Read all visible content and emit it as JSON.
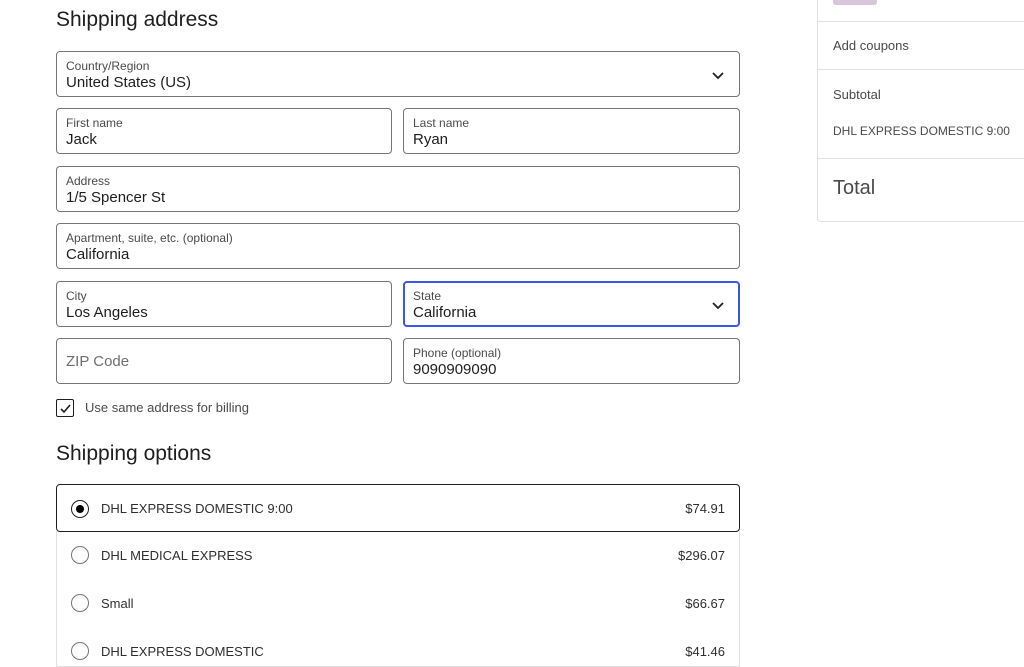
{
  "shipping": {
    "title": "Shipping address",
    "country": {
      "label": "Country/Region",
      "value": "United States (US)"
    },
    "first_name": {
      "label": "First name",
      "value": "Jack"
    },
    "last_name": {
      "label": "Last name",
      "value": "Ryan"
    },
    "address": {
      "label": "Address",
      "value": "1/5 Spencer St"
    },
    "apartment": {
      "label": "Apartment, suite, etc. (optional)",
      "value": "California"
    },
    "city": {
      "label": "City",
      "value": "Los Angeles"
    },
    "state": {
      "label": "State",
      "value": "California"
    },
    "zip": {
      "placeholder": "ZIP Code",
      "value": ""
    },
    "phone": {
      "label": "Phone (optional)",
      "value": "9090909090"
    },
    "billing_same": {
      "label": "Use same address for billing",
      "checked": true
    }
  },
  "options": {
    "title": "Shipping options",
    "items": [
      {
        "name": "DHL EXPRESS DOMESTIC 9:00",
        "price": "$74.91",
        "selected": true
      },
      {
        "name": "DHL MEDICAL EXPRESS",
        "price": "$296.07",
        "selected": false
      },
      {
        "name": "Small",
        "price": "$66.67",
        "selected": false
      },
      {
        "name": "DHL EXPRESS DOMESTIC",
        "price": "$41.46",
        "selected": false
      }
    ]
  },
  "summary": {
    "add_coupons": "Add coupons",
    "subtotal": "Subtotal",
    "shipping_method": "DHL EXPRESS DOMESTIC 9:00",
    "total": "Total"
  },
  "colors": {
    "focus": "#3858e9",
    "border": "#757575",
    "divider": "#e0e0e0"
  },
  "icons": [
    "chevron-down-icon",
    "checkmark-icon",
    "radio-icon",
    "product-thumbnail"
  ]
}
